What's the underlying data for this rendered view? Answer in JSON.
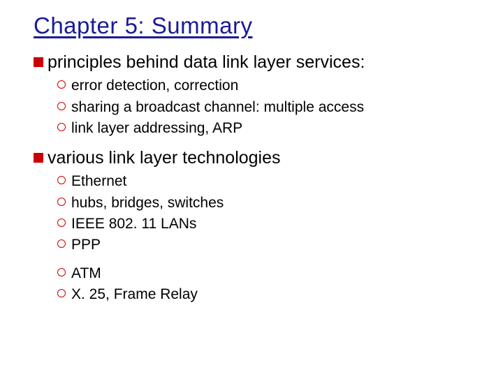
{
  "title": "Chapter 5: Summary",
  "sections": [
    {
      "heading": "principles behind data link layer services:",
      "items": [
        "error detection, correction",
        "sharing a broadcast channel: multiple access",
        "link layer addressing, ARP"
      ]
    },
    {
      "heading": "various link layer technologies",
      "items": [
        "Ethernet",
        "hubs, bridges, switches",
        "IEEE 802. 11 LANs",
        "PPP"
      ],
      "items2": [
        "ATM",
        "X. 25, Frame Relay"
      ]
    }
  ]
}
